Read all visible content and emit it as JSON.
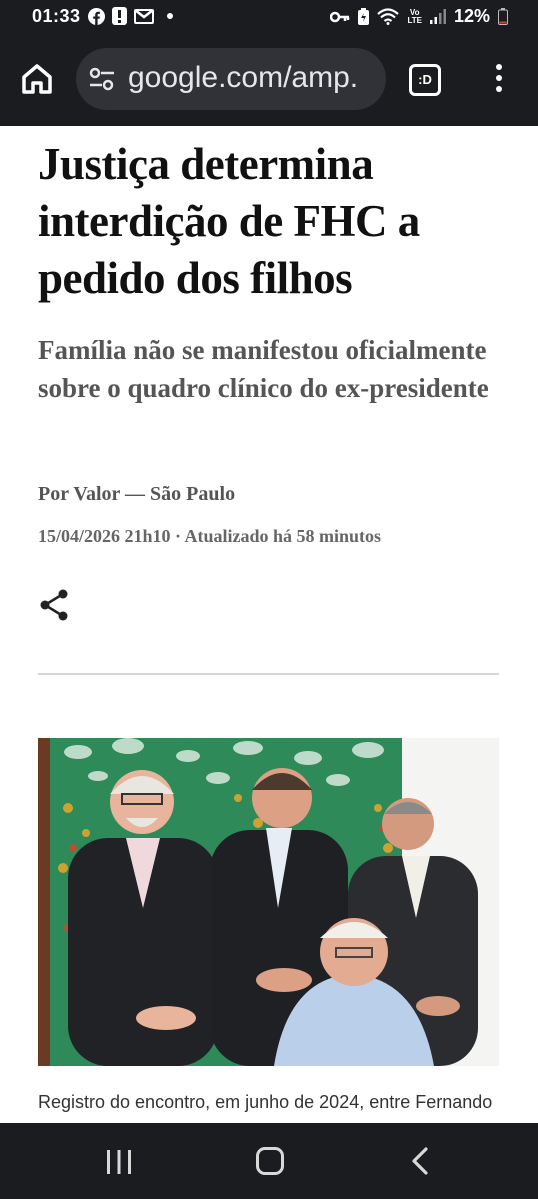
{
  "status": {
    "time": "01:33",
    "battery": "12%",
    "network": "LTE"
  },
  "browser": {
    "url": "google.com/amp.",
    "tabs_label": ":D"
  },
  "article": {
    "headline": "Justiça determina interdição de FHC a pedido dos filhos",
    "subtitle": "Família não se manifestou oficialmente sobre o quadro clínico do ex-presidente",
    "byline": "Por Valor — São Paulo",
    "dateline": "15/04/2026 21h10 · Atualizado há 58 minutos",
    "caption": "Registro do encontro, em junho de 2024, entre Fernando"
  },
  "icons": {
    "home": "home-icon",
    "tune": "tune-icon",
    "menu": "more-vert-icon",
    "share": "share-icon",
    "recent": "recent-apps-icon",
    "back": "back-icon"
  },
  "colors": {
    "chrome_bar": "#1b1c20",
    "url_pill": "#303238",
    "headline": "#111111",
    "subtitle": "#555555"
  }
}
